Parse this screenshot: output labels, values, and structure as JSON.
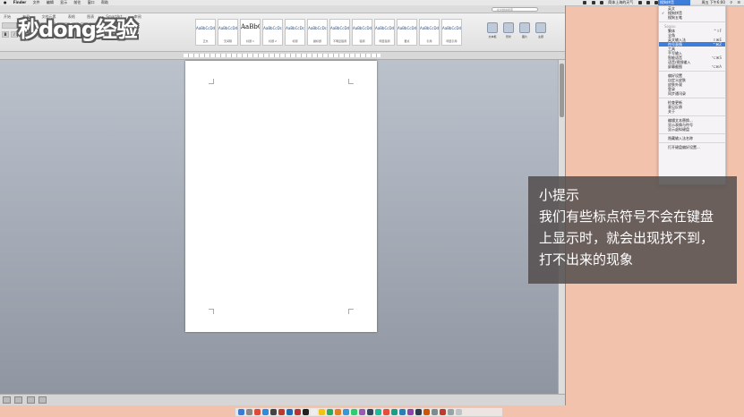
{
  "menubar": {
    "app": "Finder",
    "items": [
      "文件",
      "编辑",
      "显示",
      "前往",
      "窗口",
      "帮助"
    ],
    "status_text": "简体上海的天气",
    "time": "周五 下午6:00"
  },
  "watermark": {
    "logo": "秒dong经验"
  },
  "word": {
    "ribbon_tabs": [
      "开始",
      "布局",
      "文档元素",
      "表格",
      "图表",
      "SmartArt",
      "审阅"
    ],
    "search_placeholder": "在文档中搜索",
    "styles": [
      {
        "sample": "AaBbCcDdE",
        "name": "正文"
      },
      {
        "sample": "AaBbCcDdE",
        "name": "无间隔"
      },
      {
        "sample": "AaBbC",
        "name": "标题 1"
      },
      {
        "sample": "AaBbCcDc",
        "name": "标题 2"
      },
      {
        "sample": "AaBbCcDc",
        "name": "标题"
      },
      {
        "sample": "AaBbCcDc",
        "name": "副标题"
      },
      {
        "sample": "AaBbCcDdE",
        "name": "不明显强调"
      },
      {
        "sample": "AaBbCcDdE",
        "name": "强调"
      },
      {
        "sample": "AaBbCcDdE",
        "name": "明显强调"
      },
      {
        "sample": "AaBbCcDdE",
        "name": "要点"
      },
      {
        "sample": "AaBbCcDdE",
        "name": "引用"
      },
      {
        "sample": "AaBbCcDdE",
        "name": "明显引用"
      }
    ],
    "right_buttons": [
      "文本框",
      "形状",
      "图片",
      "主题"
    ]
  },
  "ime_menu": {
    "header": "搜狗拼音",
    "items": [
      {
        "label": "英文",
        "shortcut": "",
        "checked": false
      },
      {
        "label": "搜狗拼音",
        "shortcut": "",
        "checked": true
      },
      {
        "label": "搜狗五笔",
        "shortcut": "",
        "checked": false
      },
      {
        "label": "Sogou",
        "shortcut": "",
        "checked": false,
        "header": true
      },
      {
        "label": "繁体",
        "shortcut": "^⇧F",
        "checked": false
      },
      {
        "label": "全角",
        "shortcut": "",
        "checked": false
      },
      {
        "label": "英文输入法",
        "shortcut": "⇧⌘E",
        "checked": false
      },
      {
        "label": "符号表情",
        "shortcut": "⌃⌘Z",
        "checked": false,
        "highlight": true
      },
      {
        "label": "工具",
        "shortcut": "",
        "checked": false
      },
      {
        "label": "手写输入",
        "shortcut": "",
        "checked": false
      },
      {
        "label": "智能语音",
        "shortcut": "⌥⌘S",
        "checked": false
      },
      {
        "label": "语音/视频输入",
        "shortcut": "",
        "checked": false
      },
      {
        "label": "屏幕截图",
        "shortcut": "⌥⌘A",
        "checked": false
      },
      {
        "label": "偏好设置",
        "shortcut": "",
        "checked": false
      },
      {
        "label": "自定义皮肤",
        "shortcut": "",
        "checked": false
      },
      {
        "label": "皮肤外观",
        "shortcut": "",
        "checked": false
      },
      {
        "label": "登录",
        "shortcut": "",
        "checked": false
      },
      {
        "label": "同步通讯录",
        "shortcut": "",
        "checked": false
      },
      {
        "label": "检查更新",
        "shortcut": "",
        "checked": false
      },
      {
        "label": "意见反馈",
        "shortcut": "",
        "checked": false
      },
      {
        "label": "关于",
        "shortcut": "",
        "checked": false
      },
      {
        "label": "编辑文本替换...",
        "shortcut": "",
        "checked": false
      },
      {
        "label": "显示表情与符号",
        "shortcut": "",
        "checked": false
      },
      {
        "label": "显示虚拟键盘",
        "shortcut": "",
        "checked": false
      },
      {
        "label": "隐藏输入法名称",
        "shortcut": "",
        "checked": false
      },
      {
        "label": "打开键盘偏好设置...",
        "shortcut": "",
        "checked": false
      }
    ]
  },
  "tip": {
    "title": "小提示",
    "lines": [
      "我们有些标点符号不会在键盘",
      "上显示时，就会出现找不到，",
      "打不出来的现象"
    ]
  },
  "colors": {
    "desktop": "#f3c2ad",
    "menu_highlight": "#3d7ddc",
    "tip_bg": "#544e4e"
  }
}
